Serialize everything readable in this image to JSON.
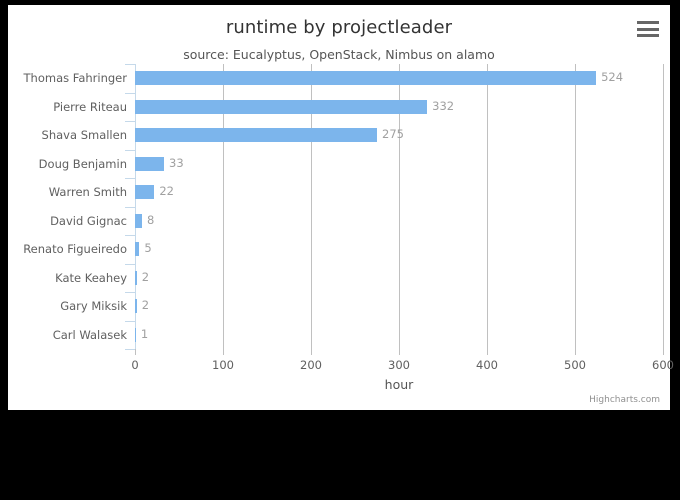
{
  "chart_data": {
    "type": "bar",
    "title": "runtime by projectleader",
    "subtitle": "source: Eucalyptus, OpenStack, Nimbus on alamo",
    "xlabel": "hour",
    "ylabel": "",
    "orientation": "horizontal",
    "grid": true,
    "legend": false,
    "xlim": [
      0,
      600
    ],
    "xticks": [
      0,
      100,
      200,
      300,
      400,
      500,
      600
    ],
    "categories": [
      "Thomas Fahringer",
      "Pierre Riteau",
      "Shava Smallen",
      "Doug Benjamin",
      "Warren Smith",
      "David Gignac",
      "Renato Figueiredo",
      "Kate Keahey",
      "Gary Miksik",
      "Carl Walasek"
    ],
    "values": [
      524,
      332,
      275,
      33,
      22,
      8,
      5,
      2,
      2,
      1
    ],
    "data_labels": [
      "524",
      "332",
      "275",
      "33",
      "22",
      "8",
      "5",
      "2",
      "2",
      "1"
    ],
    "series": [
      {
        "name": "hour",
        "values": [
          524,
          332,
          275,
          33,
          22,
          8,
          5,
          2,
          2,
          1
        ]
      }
    ],
    "bar_color": "#7cb5ec",
    "label_color": "#a0a0a0",
    "axis_color": "#606060",
    "gridline_color": "#c0c0c0"
  },
  "context_menu": {
    "icon": "hamburger-menu-icon"
  },
  "credits": {
    "text": "Highcharts.com"
  }
}
